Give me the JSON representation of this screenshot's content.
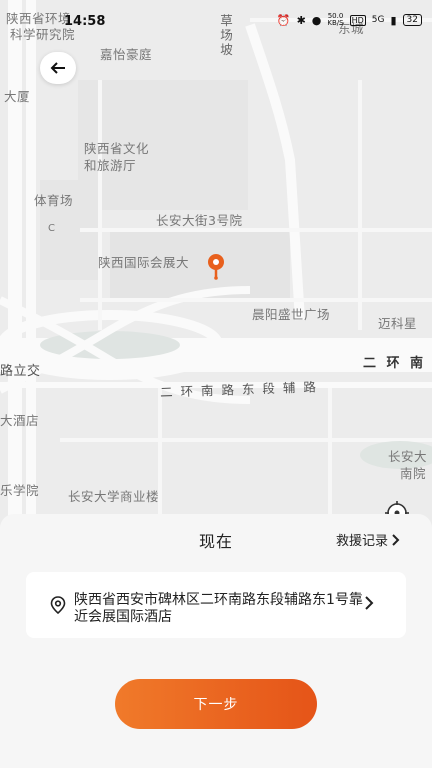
{
  "status_bar": {
    "time": "14:58",
    "network_speed": "50.0",
    "network_unit": "KB/S",
    "hd": "HD",
    "signal": "5G",
    "battery": "32"
  },
  "map": {
    "labels": {
      "shaanxi_env": "陕西省环境",
      "research_inst": "科学研究院",
      "jiayi": "嘉怡豪庭",
      "dasha": "大厦",
      "culture_1": "陕西省文化",
      "culture_2": "和旅游厅",
      "gym": "体育场",
      "changan_3": "长安大街3号院",
      "expo": "陕西国际会展大",
      "chenyang": "晨阳盛世广场",
      "lulijiao": "路立交",
      "second_ring": "二 环 南 路",
      "auxiliary": "二 环 南 路 东 段 辅 路",
      "jiudian": "大酒店",
      "xueyuan": "乐学院",
      "changan_mall": "长安大学商业楼",
      "changan_u": "长安大",
      "nanyuan": "南院",
      "keli": "迈科星",
      "caochangpo": "草场坡",
      "dongfang": "东城",
      "c_marker": "C"
    }
  },
  "sheet": {
    "title": "现在",
    "rescue_link": "救援记录",
    "address": "陕西省西安市碑林区二环南路东段辅路东1号靠近会展国际酒店",
    "next_button": "下一步"
  },
  "colors": {
    "accent": "#e8601d",
    "pin": "#e8601d"
  }
}
